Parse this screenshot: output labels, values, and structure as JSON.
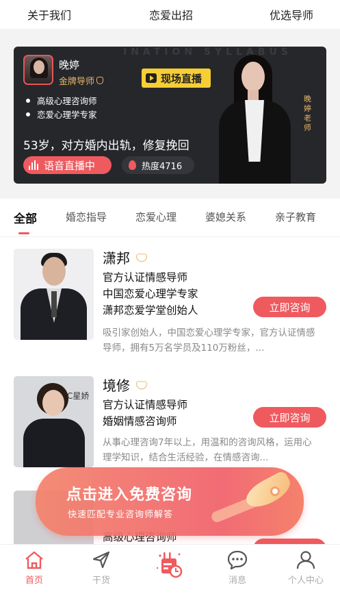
{
  "top_nav": [
    "关于我们",
    "恋爱出招",
    "优选导师"
  ],
  "banner": {
    "watermark": "INATION SYLLABUS",
    "host_name": "晚婷",
    "host_rank": "金牌导师",
    "bullets": [
      "高级心理咨询师",
      "恋爱心理学专家"
    ],
    "live_tag": "现场直播",
    "headline": "53岁，对方婚内出轨，修复挽回",
    "voice_label": "语音直播中",
    "heat_label": "热度4716",
    "teacher_tag": "晚婷老师"
  },
  "tabs": [
    "全部",
    "婚恋指导",
    "恋爱心理",
    "婆媳关系",
    "亲子教育"
  ],
  "active_tab": 0,
  "counselors": [
    {
      "name": "潇邦",
      "titles": [
        "官方认证情感导师",
        "中国恋爱心理学专家",
        "潇邦恋爱学堂创始人"
      ],
      "description": "吸引家创始人，中国恋爱心理学专家，官方认证情感导师，拥有5万名学员及110万粉丝，...",
      "button": "立即咨询"
    },
    {
      "name": "境修",
      "photo_logo": "C星娇",
      "titles": [
        "官方认证情感导师",
        "婚姻情感咨询师"
      ],
      "description": "从事心理咨询7年以上，用温和的咨询风格，运用心理学知识，结合生活经验，在情感咨询...",
      "button": "立即咨询"
    },
    {
      "name": "",
      "titles": [
        "高级心理咨询师"
      ],
      "description": "",
      "button": "立即咨询"
    }
  ],
  "float_banner": {
    "headline": "点击进入免费咨询",
    "sub": "快速匹配专业咨询师解答"
  },
  "bottom_nav": [
    {
      "label": "首页",
      "icon": "home-icon",
      "active": true
    },
    {
      "label": "干货",
      "icon": "send-icon",
      "active": false
    },
    {
      "label": "",
      "icon": "calendar-clock-icon",
      "active": false
    },
    {
      "label": "消息",
      "icon": "chat-icon",
      "active": false
    },
    {
      "label": "个人中心",
      "icon": "user-icon",
      "active": false
    }
  ],
  "colors": {
    "accent": "#ef5a5f",
    "gold": "#e7b56a",
    "banner_bg": "#26272b",
    "live_tag": "#f7cf35"
  }
}
